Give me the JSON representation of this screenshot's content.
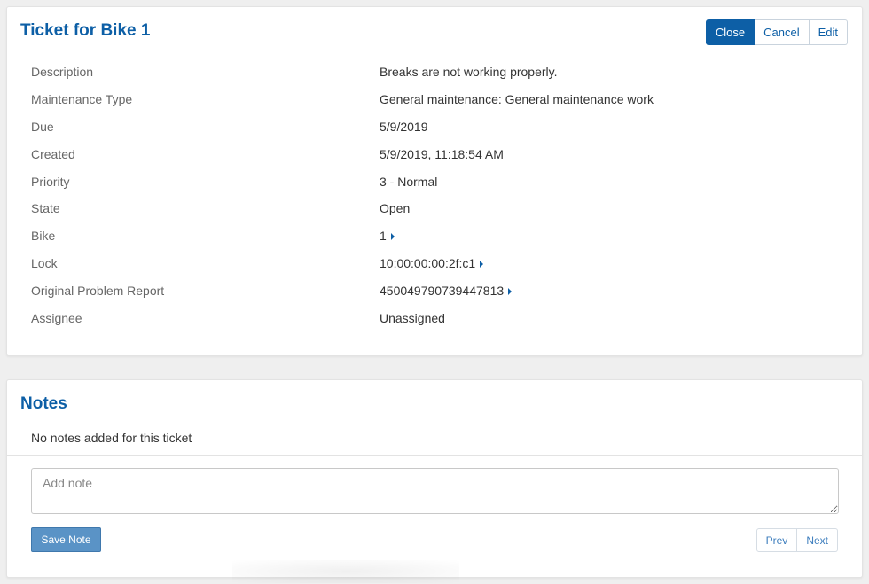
{
  "ticket": {
    "title": "Ticket for Bike 1",
    "actions": {
      "close_label": "Close",
      "cancel_label": "Cancel",
      "edit_label": "Edit"
    },
    "fields": [
      {
        "label": "Description",
        "value": "Breaks are not working properly."
      },
      {
        "label": "Maintenance Type",
        "value": "General maintenance: General maintenance work"
      },
      {
        "label": "Due",
        "value": "5/9/2019"
      },
      {
        "label": "Created",
        "value": "5/9/2019, 11:18:54 AM"
      },
      {
        "label": "Priority",
        "value": "3 - Normal"
      },
      {
        "label": "State",
        "value": "Open"
      },
      {
        "label": "Bike",
        "value": "1"
      },
      {
        "label": "Lock",
        "value": "10:00:00:00:2f:c1"
      },
      {
        "label": "Original Problem Report",
        "value": "450049790739447813"
      },
      {
        "label": "Assignee",
        "value": "Unassigned"
      }
    ]
  },
  "notes": {
    "title": "Notes",
    "empty_text": "No notes added for this ticket",
    "input_placeholder": "Add note",
    "save_label": "Save Note",
    "prev_label": "Prev",
    "next_label": "Next"
  },
  "colors": {
    "accent": "#0d5fa6",
    "background": "#efefef",
    "save_button": "#5a93c6"
  }
}
